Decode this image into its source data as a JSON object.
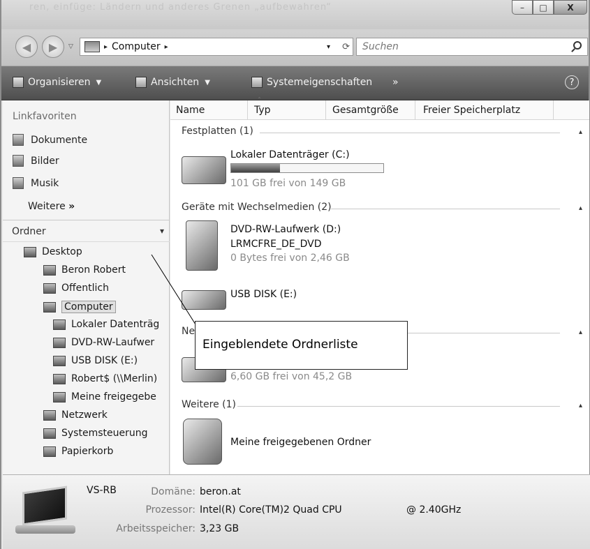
{
  "window": {
    "title_faded": "ren, einfüge: Ländern und anderes Grenen „aufbewahren“",
    "buttons": {
      "minimize": "–",
      "maximize": "□",
      "close": "X"
    }
  },
  "address": {
    "back_icon": "back-arrow-icon",
    "forward_icon": "forward-arrow-icon",
    "crumb_arrow": "▸",
    "location": "Computer",
    "crumb_tail": "▸",
    "dropdown": "▾",
    "refresh": "⟳",
    "search_placeholder": "Suchen"
  },
  "toolbar": {
    "organize": "Organisieren",
    "views": "Ansichten",
    "system_properties": "Systemeigenschaften",
    "more": "»",
    "help": "?"
  },
  "sidebar": {
    "favorites_header": "Linkfavoriten",
    "favorites": [
      "Dokumente",
      "Bilder",
      "Musik"
    ],
    "more": "Weitere",
    "more_glyph": "»",
    "folders_header": "Ordner",
    "folders_chevron": "▾",
    "tree": [
      "Desktop",
      "Beron Robert",
      "Öffentlich",
      "Computer",
      "Lokaler Datenträg",
      "DVD-RW-Laufwer",
      "USB DISK (E:)",
      "Robert$ (\\\\Merlin)",
      "Meine freigegebe",
      "Netzwerk",
      "Systemsteuerung",
      "Papierkorb"
    ]
  },
  "columns": [
    "Name",
    "Typ",
    "Gesamtgröße",
    "Freier Speicherplatz"
  ],
  "groups": {
    "hard_disks": "Festplatten (1)",
    "removable": "Geräte mit Wechselmedien (2)",
    "network_partial": "Netz",
    "more": "Weitere (1)",
    "caret": "▴"
  },
  "items": {
    "local_disk": {
      "name": "Lokaler Datenträger (C:)",
      "free": "101 GB frei von 149 GB",
      "used_fraction": 0.32
    },
    "dvd": {
      "name": "DVD-RW-Laufwerk (D:)",
      "label": "LRMCFRE_DE_DVD",
      "free": "0 Bytes frei von 2,46 GB"
    },
    "usb": {
      "name": "USB DISK (E:)"
    },
    "network_drive": {
      "free": "6,60 GB frei von 45,2 GB"
    },
    "shared": {
      "name": "Meine freigegebenen Ordner"
    }
  },
  "callout": "Eingeblendete Ordnerliste",
  "details": {
    "computer_name": "VS-RB",
    "domain_label": "Domäne:",
    "domain_value": "beron.at",
    "cpu_label": "Prozessor:",
    "cpu_value": "Intel(R) Core(TM)2 Quad CPU",
    "cpu_speed": "@ 2.40GHz",
    "ram_label": "Arbeitsspeicher:",
    "ram_value": "3,23 GB"
  }
}
